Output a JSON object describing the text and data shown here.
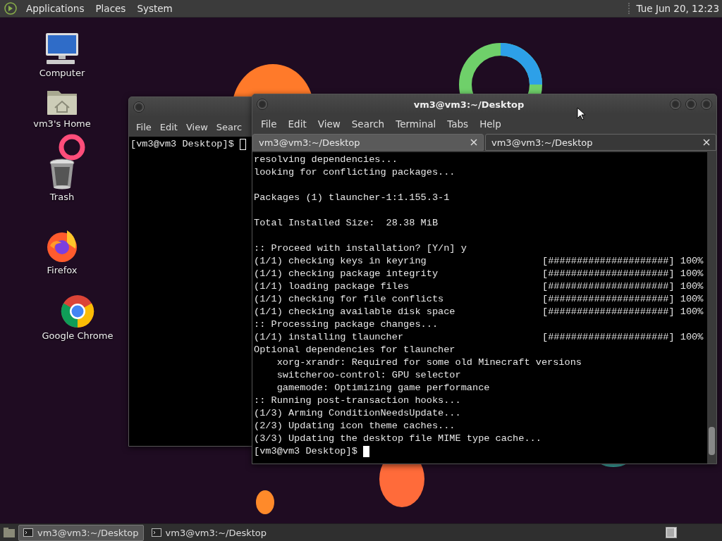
{
  "top_panel": {
    "menus": [
      "Applications",
      "Places",
      "System"
    ],
    "clock": "Tue Jun 20, 12:23"
  },
  "desktop_icons": [
    {
      "kind": "computer",
      "label": "Computer"
    },
    {
      "kind": "home",
      "label": "vm3's Home"
    },
    {
      "kind": "trash",
      "label": "Trash"
    },
    {
      "kind": "firefox",
      "label": "Firefox"
    },
    {
      "kind": "chrome",
      "label": "Google Chrome"
    }
  ],
  "back_window": {
    "menus": [
      "File",
      "Edit",
      "View",
      "Searc"
    ],
    "prompt": "[vm3@vm3 Desktop]$"
  },
  "terminal": {
    "title": "vm3@vm3:~/Desktop",
    "menus": [
      "File",
      "Edit",
      "View",
      "Search",
      "Terminal",
      "Tabs",
      "Help"
    ],
    "tabs": [
      {
        "label": "vm3@vm3:~/Desktop",
        "selected": false
      },
      {
        "label": "vm3@vm3:~/Desktop",
        "selected": true
      }
    ],
    "lines": [
      {
        "text": "resolving dependencies..."
      },
      {
        "text": "looking for conflicting packages..."
      },
      {
        "kind": "blank"
      },
      {
        "text": "Packages (1) tlauncher-1:1.155.3-1"
      },
      {
        "kind": "blank"
      },
      {
        "text": "Total Installed Size:  28.38 MiB"
      },
      {
        "kind": "blank"
      },
      {
        "text": ":: Proceed with installation? [Y/n] y"
      },
      {
        "text": "(1/1) checking keys in keyring",
        "progress": "[#####################] 100%"
      },
      {
        "text": "(1/1) checking package integrity",
        "progress": "[#####################] 100%"
      },
      {
        "text": "(1/1) loading package files",
        "progress": "[#####################] 100%"
      },
      {
        "text": "(1/1) checking for file conflicts",
        "progress": "[#####################] 100%"
      },
      {
        "text": "(1/1) checking available disk space",
        "progress": "[#####################] 100%"
      },
      {
        "text": ":: Processing package changes..."
      },
      {
        "text": "(1/1) installing tlauncher",
        "progress": "[#####################] 100%"
      },
      {
        "text": "Optional dependencies for tlauncher"
      },
      {
        "text": "    xorg-xrandr: Required for some old Minecraft versions"
      },
      {
        "text": "    switcheroo-control: GPU selector"
      },
      {
        "text": "    gamemode: Optimizing game performance"
      },
      {
        "text": ":: Running post-transaction hooks..."
      },
      {
        "text": "(1/3) Arming ConditionNeedsUpdate..."
      },
      {
        "text": "(2/3) Updating icon theme caches..."
      },
      {
        "text": "(3/3) Updating the desktop file MIME type cache..."
      }
    ],
    "prompt": "[vm3@vm3 Desktop]$"
  },
  "taskbar": {
    "tasks": [
      {
        "label": "vm3@vm3:~/Desktop",
        "selected": true
      },
      {
        "label": "vm3@vm3:~/Desktop",
        "selected": false
      }
    ]
  }
}
